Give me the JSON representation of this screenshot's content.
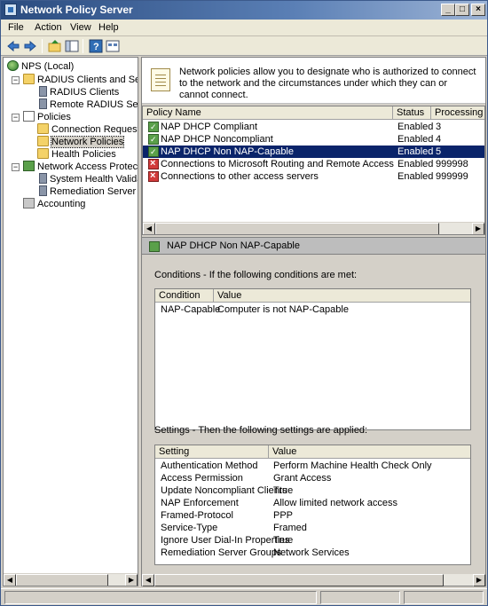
{
  "window": {
    "title": "Network Policy Server"
  },
  "menu": [
    "File",
    "Action",
    "View",
    "Help"
  ],
  "tree": {
    "items": [
      {
        "label": "NPS (Local)"
      },
      {
        "label": "RADIUS Clients and Servers"
      },
      {
        "label": "RADIUS Clients"
      },
      {
        "label": "Remote RADIUS Server Groups"
      },
      {
        "label": "Policies"
      },
      {
        "label": "Connection Request Policies"
      },
      {
        "label": "Network Policies"
      },
      {
        "label": "Health Policies"
      },
      {
        "label": "Network Access Protection"
      },
      {
        "label": "System Health Validators"
      },
      {
        "label": "Remediation Server Groups"
      },
      {
        "label": "Accounting"
      }
    ]
  },
  "description": "Network policies allow you to designate who is authorized to connect to the network and the circumstances under which they can or cannot connect.",
  "policies": {
    "columns": [
      "Policy Name",
      "Status",
      "Processing Order"
    ],
    "rows": [
      {
        "name": "NAP DHCP Compliant",
        "status": "Enabled",
        "order": "3",
        "icon": "grant"
      },
      {
        "name": "NAP DHCP Noncompliant",
        "status": "Enabled",
        "order": "4",
        "icon": "grant"
      },
      {
        "name": "NAP DHCP Non NAP-Capable",
        "status": "Enabled",
        "order": "5",
        "icon": "grant",
        "selected": true
      },
      {
        "name": "Connections to Microsoft Routing and Remote Access server",
        "status": "Enabled",
        "order": "999998",
        "icon": "deny"
      },
      {
        "name": "Connections to other access servers",
        "status": "Enabled",
        "order": "999999",
        "icon": "deny"
      }
    ]
  },
  "detail": {
    "title": "NAP DHCP Non NAP-Capable",
    "conditions_label": "Conditions - If the following conditions are met:",
    "conditions_columns": [
      "Condition",
      "Value"
    ],
    "conditions": [
      {
        "condition": "NAP-Capable",
        "value": "Computer is not NAP-Capable"
      }
    ],
    "settings_label": "Settings - Then the following settings are applied:",
    "settings_columns": [
      "Setting",
      "Value"
    ],
    "settings": [
      {
        "setting": "Authentication Method",
        "value": "Perform Machine Health Check Only"
      },
      {
        "setting": "Access Permission",
        "value": "Grant Access"
      },
      {
        "setting": "Update Noncompliant Clients",
        "value": "True"
      },
      {
        "setting": "NAP Enforcement",
        "value": "Allow limited network access"
      },
      {
        "setting": "Framed-Protocol",
        "value": "PPP"
      },
      {
        "setting": "Service-Type",
        "value": "Framed"
      },
      {
        "setting": "Ignore User Dial-In Properties",
        "value": "True"
      },
      {
        "setting": "Remediation Server Groups",
        "value": "Network Services"
      }
    ]
  }
}
